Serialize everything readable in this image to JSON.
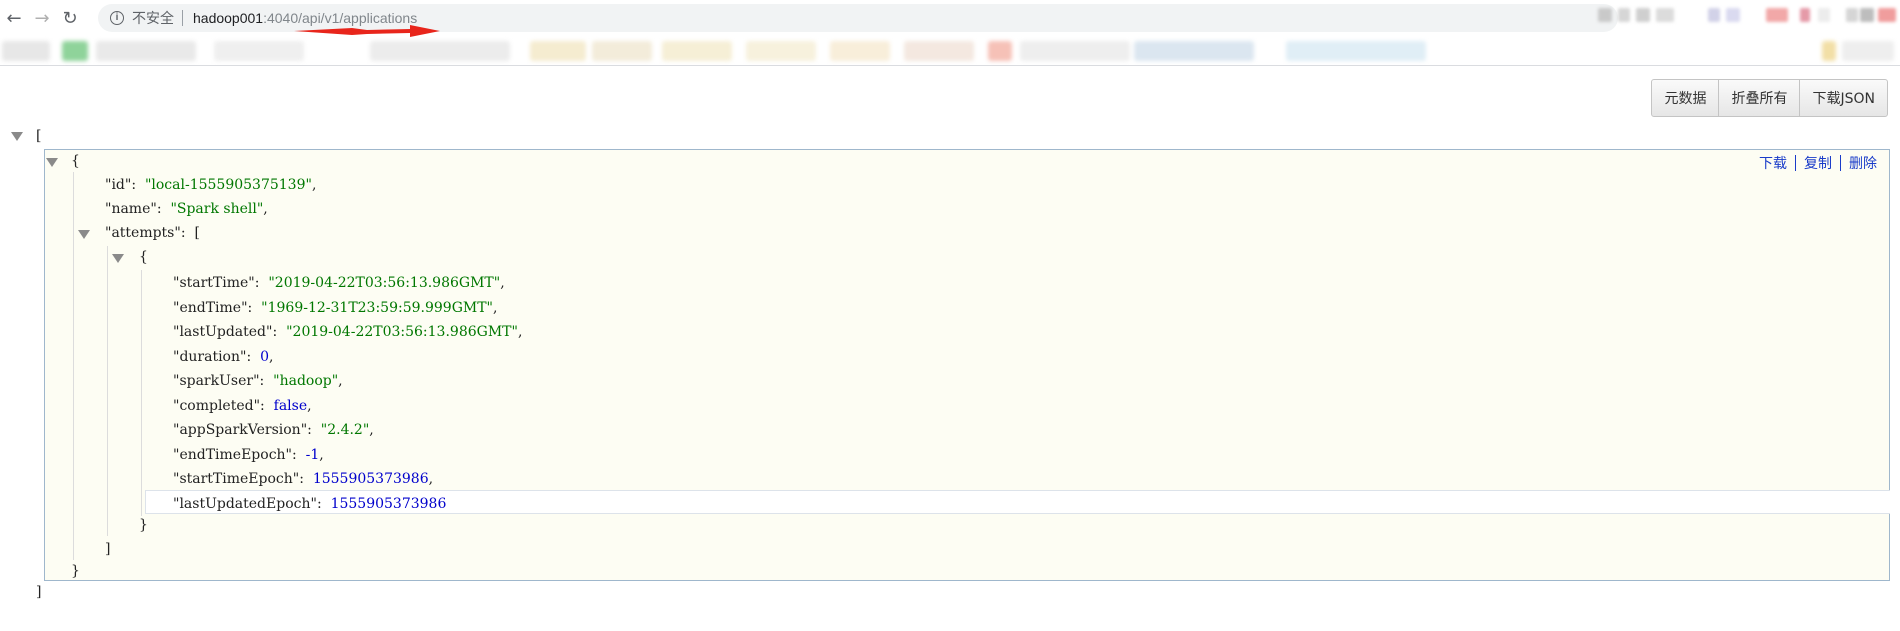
{
  "browser": {
    "security_label": "不安全",
    "url_host": "hadoop001",
    "url_path": ":4040/api/v1/applications"
  },
  "toolbar": {
    "metadata_label": "元数据",
    "collapse_all_label": "折叠所有",
    "download_json_label": "下载JSON"
  },
  "object_actions": {
    "download_label": "下载",
    "copy_label": "复制",
    "delete_label": "删除"
  },
  "json": {
    "open_array": "[",
    "close_array": "]",
    "open_object": "{",
    "close_object": "}",
    "id_key": "\"id\"",
    "id_value": "\"local-1555905375139\"",
    "name_key": "\"name\"",
    "name_value": "\"Spark shell\"",
    "attempts_key": "\"attempts\"",
    "attempt": [
      {
        "key": "\"startTime\"",
        "value": "\"2019-04-22T03:56:13.986GMT\"",
        "kind": "str",
        "comma": ","
      },
      {
        "key": "\"endTime\"",
        "value": "\"1969-12-31T23:59:59.999GMT\"",
        "kind": "str",
        "comma": ","
      },
      {
        "key": "\"lastUpdated\"",
        "value": "\"2019-04-22T03:56:13.986GMT\"",
        "kind": "str",
        "comma": ","
      },
      {
        "key": "\"duration\"",
        "value": "0",
        "kind": "num",
        "comma": ","
      },
      {
        "key": "\"sparkUser\"",
        "value": "\"hadoop\"",
        "kind": "str",
        "comma": ","
      },
      {
        "key": "\"completed\"",
        "value": "false",
        "kind": "bool",
        "comma": ","
      },
      {
        "key": "\"appSparkVersion\"",
        "value": "\"2.4.2\"",
        "kind": "str",
        "comma": ","
      },
      {
        "key": "\"endTimeEpoch\"",
        "value": "-1",
        "kind": "num",
        "comma": ","
      },
      {
        "key": "\"startTimeEpoch\"",
        "value": "1555905373986",
        "kind": "num",
        "comma": ","
      },
      {
        "key": "\"lastUpdatedEpoch\"",
        "value": "1555905373986",
        "kind": "num",
        "comma": ""
      }
    ]
  }
}
